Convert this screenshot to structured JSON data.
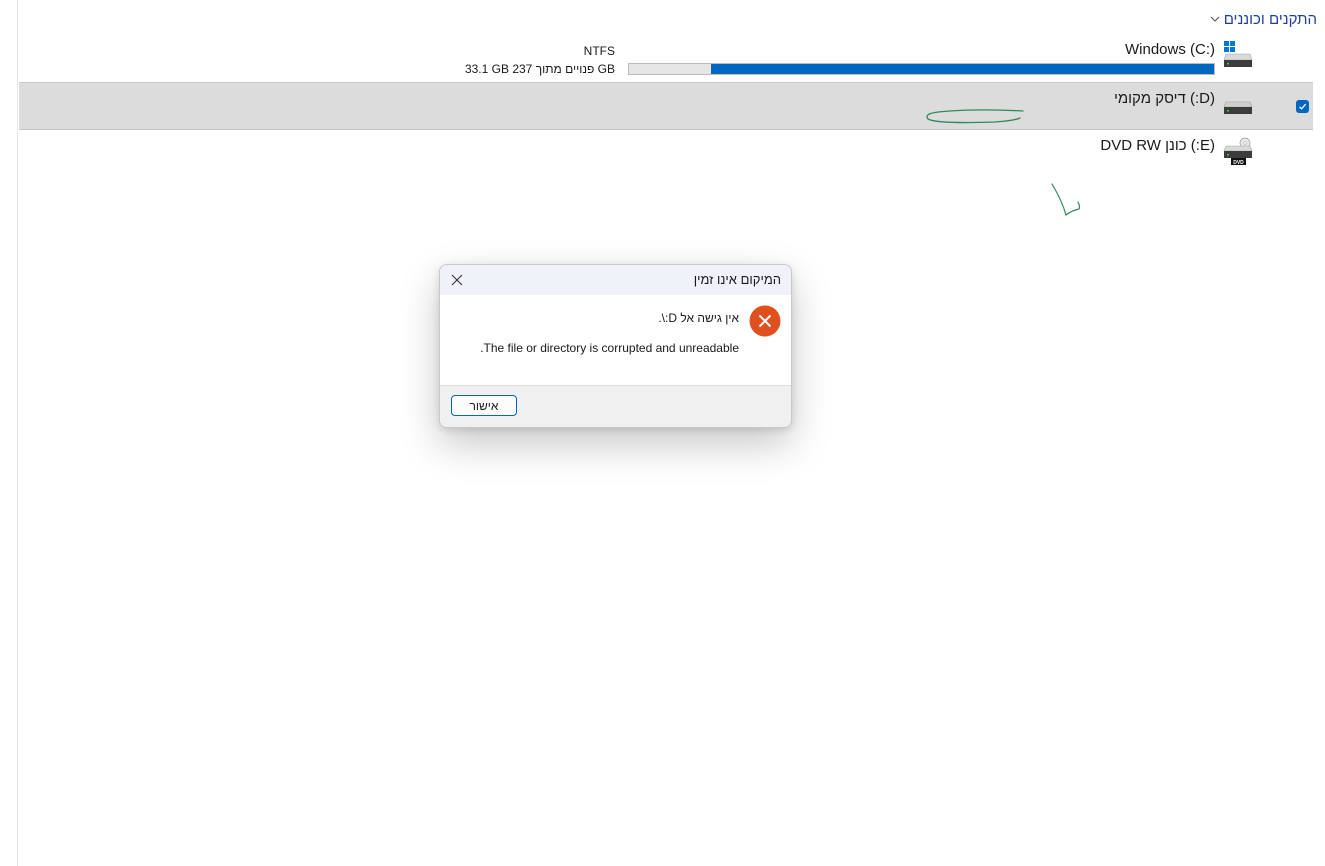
{
  "section": {
    "title": "התקנים וכוננים"
  },
  "drives": {
    "c": {
      "name": "Windows (C:)",
      "filesystem": "NTFS",
      "space_text": "33.1 GB פנויים מתוך 237 GB",
      "used_fraction": 0.86
    },
    "d": {
      "name": "(D:) דיסק מקומי",
      "selected": true
    },
    "e": {
      "name": "(E:) כונן DVD RW",
      "badge": "DVD"
    }
  },
  "dialog": {
    "title": "המיקום אינו זמין",
    "message_line1": "אין גישה אל D:\\.",
    "message_line2": "The file or directory is corrupted and unreadable.",
    "ok_label": "אישור"
  },
  "colors": {
    "accent": "#0067c0",
    "selection": "#dcdcdc",
    "error": "#e0501e",
    "header_link": "#1f3f99",
    "annotation": "#2e8b57"
  },
  "icons": {
    "section_toggle": "chevron-down-icon",
    "drive_c": "windows-drive-icon",
    "drive_d": "hard-drive-icon",
    "drive_e": "dvd-drive-icon",
    "dialog_close": "close-icon",
    "dialog_error": "error-icon",
    "checkbox": "checkmark-icon"
  }
}
